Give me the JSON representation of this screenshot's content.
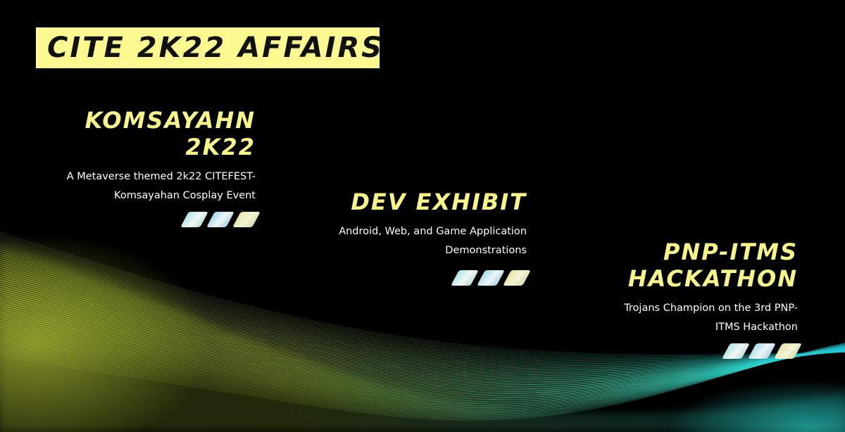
{
  "header": {
    "title": "CITE 2K22 AFFAIRS"
  },
  "cards": [
    {
      "heading_lines": [
        "KOMSAYAHN",
        "2K22"
      ],
      "desc_lines": [
        "A Metaverse themed 2k22 CITEFEST-",
        "Komsayahan Cosplay Event"
      ]
    },
    {
      "heading_lines": [
        "DEV EXHIBIT"
      ],
      "desc_lines": [
        "Android, Web, and Game Application",
        "Demonstrations"
      ]
    },
    {
      "heading_lines": [
        "PNP-ITMS",
        "HACKATHON"
      ],
      "desc_lines": [
        "Trojans Champion on the 3rd PNP-",
        "ITMS Hackathon"
      ]
    }
  ],
  "colors": {
    "title_box": "#fbf98f",
    "heading": "#f7f588",
    "background": "#000000"
  },
  "decoration": "gradient-parallelogram-icons"
}
